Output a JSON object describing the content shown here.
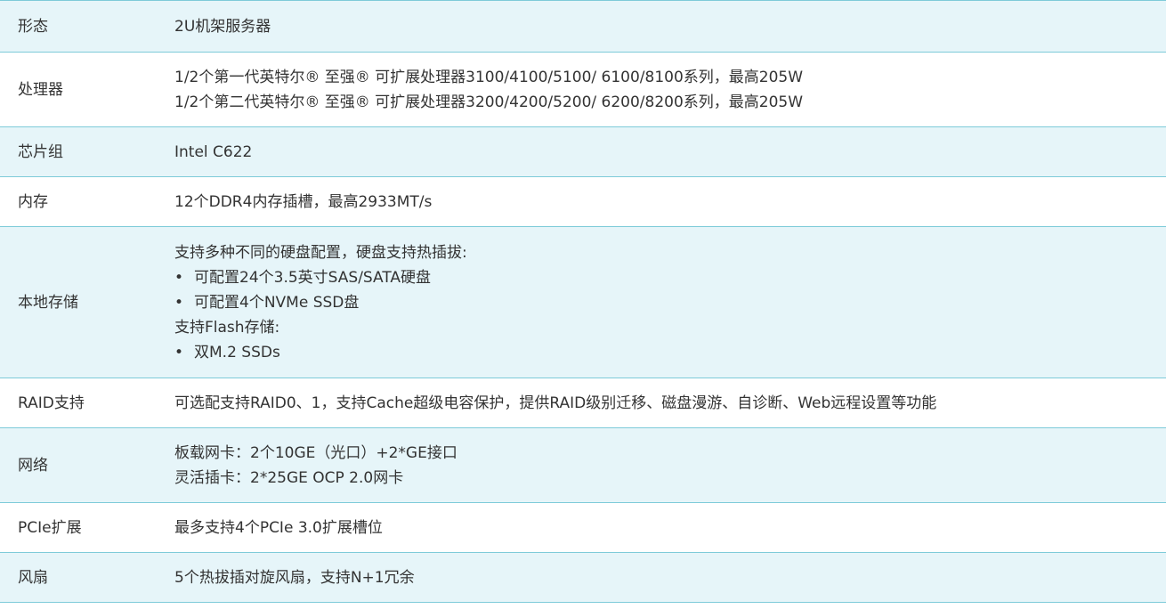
{
  "rows": [
    {
      "label": "形态",
      "lines": [
        "2U机架服务器"
      ]
    },
    {
      "label": "处理器",
      "lines": [
        "1/2个第一代英特尔® 至强® 可扩展处理器3100/4100/5100/ 6100/8100系列，最高205W",
        "1/2个第二代英特尔® 至强® 可扩展处理器3200/4200/5200/ 6200/8200系列，最高205W"
      ]
    },
    {
      "label": "芯片组",
      "lines": [
        "Intel C622"
      ]
    },
    {
      "label": "内存",
      "lines": [
        "12个DDR4内存插槽，最高2933MT/s"
      ]
    },
    {
      "label": "本地存储",
      "lines": [
        "支持多种不同的硬盘配置，硬盘支持热插拔:",
        "可配置24个3.5英寸SAS/SATA硬盘",
        "可配置4个NVMe SSD盘",
        "支持Flash存储:",
        "双M.2 SSDs"
      ],
      "bullet_symbol": "•"
    },
    {
      "label": "RAID支持",
      "lines": [
        "可选配支持RAID0、1，支持Cache超级电容保护，提供RAID级别迁移、磁盘漫游、自诊断、Web远程设置等功能"
      ]
    },
    {
      "label": "网络",
      "lines": [
        "板载网卡：2个10GE（光口）+2*GE接口",
        "灵活插卡：2*25GE  OCP 2.0网卡"
      ]
    },
    {
      "label": "PCIe扩展",
      "lines": [
        "最多支持4个PCIe 3.0扩展槽位"
      ]
    },
    {
      "label": "风扇",
      "lines": [
        "5个热拔插对旋风扇，支持N+1冗余"
      ]
    }
  ],
  "colors": {
    "row_shade": "#e6f5f9",
    "row_plain": "#ffffff",
    "border": "#7ecbd9",
    "text": "#333333"
  }
}
